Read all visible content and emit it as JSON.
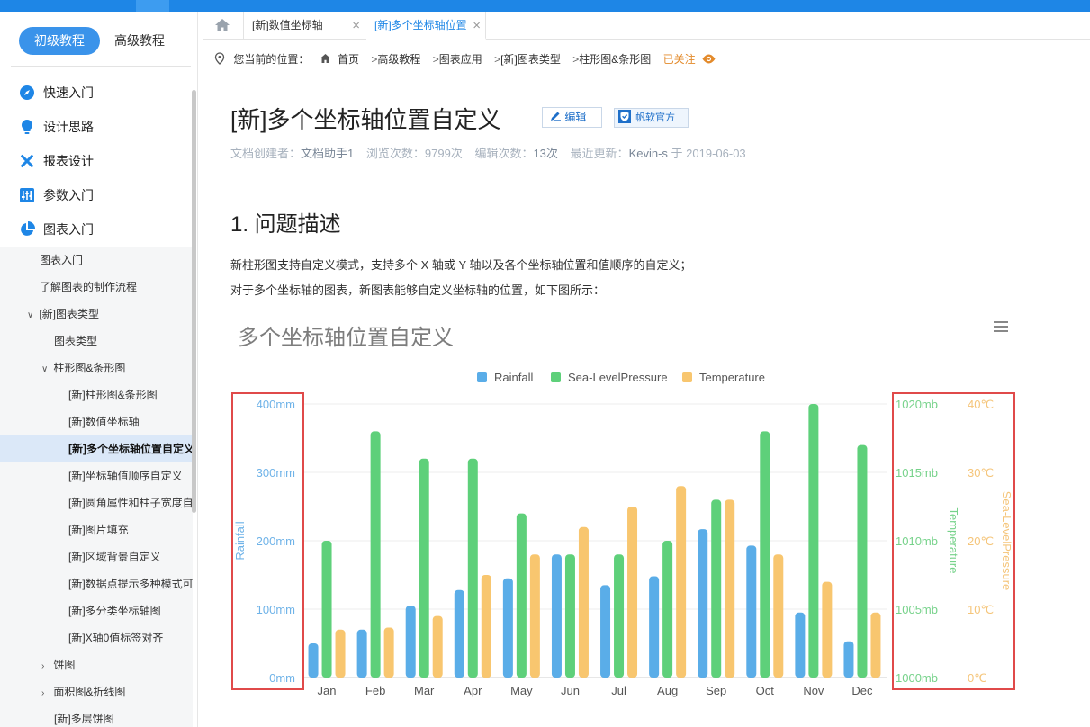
{
  "sidebar": {
    "tab_basic": "初级教程",
    "tab_advanced": "高级教程",
    "categories": [
      {
        "label": "快速入门",
        "icon": "compass-icon"
      },
      {
        "label": "设计思路",
        "icon": "lightbulb-icon"
      },
      {
        "label": "报表设计",
        "icon": "tools-icon"
      },
      {
        "label": "参数入门",
        "icon": "sliders-icon"
      },
      {
        "label": "图表入门",
        "icon": "pie-chart-icon"
      }
    ],
    "items": [
      {
        "label": "图表入门"
      },
      {
        "label": "了解图表的制作流程"
      },
      {
        "label": "[新]图表类型"
      },
      {
        "label": "图表类型"
      },
      {
        "label": "柱形图&条形图"
      },
      {
        "label": "[新]柱形图&条形图"
      },
      {
        "label": "[新]数值坐标轴"
      },
      {
        "label": "[新]多个坐标轴位置自定义"
      },
      {
        "label": "[新]坐标轴值顺序自定义"
      },
      {
        "label": "[新]圆角属性和柱子宽度自"
      },
      {
        "label": "[新]图片填充"
      },
      {
        "label": "[新]区域背景自定义"
      },
      {
        "label": "[新]数据点提示多种模式可"
      },
      {
        "label": "[新]多分类坐标轴图"
      },
      {
        "label": "[新]X轴0值标签对齐"
      },
      {
        "label": "饼图"
      },
      {
        "label": "面积图&折线图"
      },
      {
        "label": "[新]多层饼图"
      }
    ]
  },
  "tabs": {
    "tab1": "[新]数值坐标轴",
    "tab2": "[新]多个坐标轴位置自定义"
  },
  "breadcrumb": {
    "prefix": "您当前的位置：",
    "home": "首页",
    "items": [
      "高级教程",
      "图表应用",
      "[新]图表类型",
      "柱形图&条形图"
    ],
    "follow": "已关注"
  },
  "article": {
    "title": "[新]多个坐标轴位置自定义",
    "edit_label": "编辑",
    "official_label": "帆软官方",
    "meta_creator_label": "文档创建者：",
    "meta_creator": "文档助手1",
    "meta_views_label": "浏览次数：",
    "meta_views": "9799次",
    "meta_edits_label": "编辑次数：",
    "meta_edits": "13次",
    "meta_updated_label": "最近更新：",
    "meta_updated_by": "Kevin-s",
    "meta_updated_on": "于 2019-06-03",
    "section_title": "1. 问题描述",
    "para1": "新柱形图支持自定义模式，支持多个 X 轴或 Y 轴以及各个坐标轴位置和值顺序的自定义；",
    "para2": "对于多个坐标轴的图表，新图表能够自定义坐标轴的位置，如下图所示："
  },
  "chart_data": {
    "type": "bar",
    "title": "多个坐标轴位置自定义",
    "categories": [
      "Jan",
      "Feb",
      "Mar",
      "Apr",
      "May",
      "Jun",
      "Jul",
      "Aug",
      "Sep",
      "Oct",
      "Nov",
      "Dec"
    ],
    "series": [
      {
        "name": "Rainfall",
        "color": "#5aade8",
        "axis": "Rainfall",
        "values": [
          50,
          70,
          105,
          128,
          145,
          180,
          135,
          148,
          217,
          193,
          95,
          53
        ]
      },
      {
        "name": "Sea-LevelPressure",
        "color": "#5ed07a",
        "axis": "Temperature",
        "values": [
          1010,
          1018,
          1016,
          1016,
          1012,
          1009,
          1009,
          1010,
          1013,
          1018,
          1020.5,
          1017
        ]
      },
      {
        "name": "Temperature",
        "color": "#f8c66f",
        "axis": "Sea-LevelPressure",
        "values": [
          7,
          7.3,
          9,
          15,
          18,
          22,
          25,
          28,
          26,
          18,
          14,
          9.5
        ]
      }
    ],
    "axes": [
      {
        "name": "Rainfall",
        "ticks": [
          "0mm",
          "100mm",
          "200mm",
          "300mm",
          "400mm"
        ],
        "range": [
          0,
          400
        ],
        "color": "#6fb3e8"
      },
      {
        "name": "Temperature",
        "ticks": [
          "1000mb",
          "1005mb",
          "1010mb",
          "1015mb",
          "1020mb"
        ],
        "range": [
          1000,
          1020
        ],
        "color": "#76d28a"
      },
      {
        "name": "Sea-LevelPressure",
        "ticks": [
          "0℃",
          "10℃",
          "20℃",
          "30℃",
          "40℃"
        ],
        "range": [
          0,
          40
        ],
        "color": "#f5c57a"
      }
    ],
    "legend_position": "top-center",
    "grid": true
  }
}
